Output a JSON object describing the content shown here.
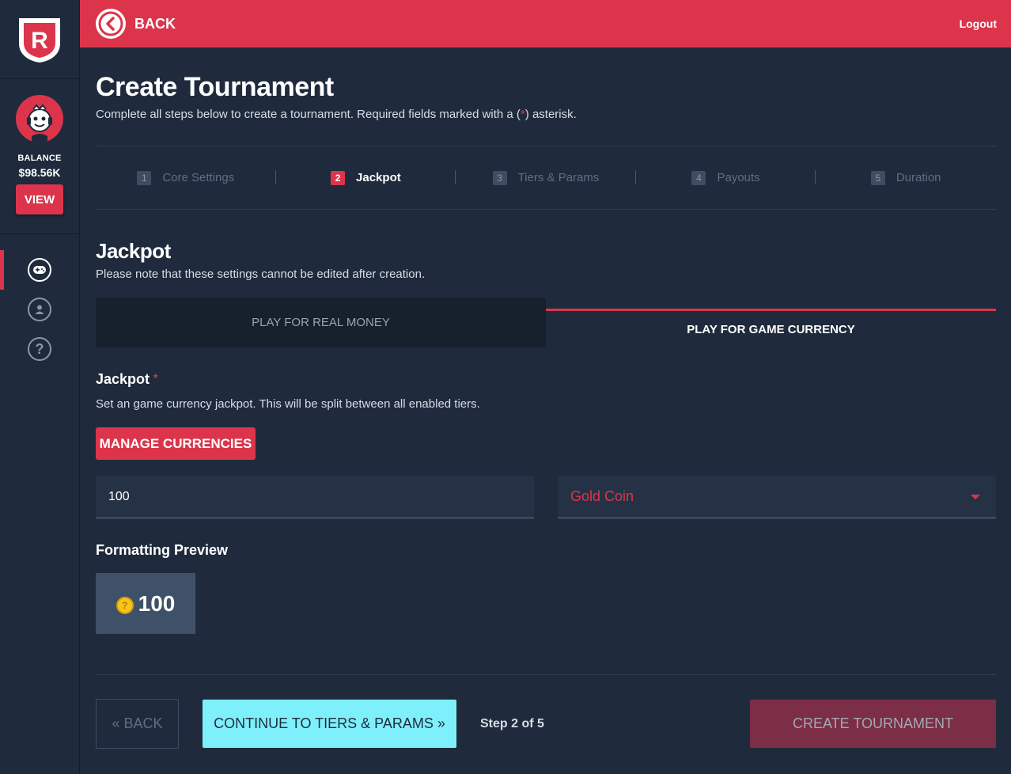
{
  "app": {
    "brand_letter": "R"
  },
  "sidebar": {
    "balance_label": "BALANCE",
    "balance_value": "$98.56K",
    "view_label": "VIEW",
    "nav": [
      {
        "icon": "gamepad-icon",
        "active": true
      },
      {
        "icon": "user-icon",
        "active": false
      },
      {
        "icon": "help-icon",
        "glyph": "?",
        "active": false
      }
    ]
  },
  "topbar": {
    "back_label": "BACK",
    "logout_label": "Logout"
  },
  "page": {
    "title": "Create Tournament",
    "subtitle_pre": "Complete all steps below to create a tournament. Required fields marked with a (",
    "subtitle_ast": "*",
    "subtitle_post": ") asterisk."
  },
  "steps": [
    {
      "num": "1",
      "label": "Core Settings",
      "active": false
    },
    {
      "num": "2",
      "label": "Jackpot",
      "active": true
    },
    {
      "num": "3",
      "label": "Tiers & Params",
      "active": false
    },
    {
      "num": "4",
      "label": "Payouts",
      "active": false
    },
    {
      "num": "5",
      "label": "Duration",
      "active": false
    }
  ],
  "section": {
    "title": "Jackpot",
    "subtitle": "Please note that these settings cannot be edited after creation."
  },
  "tabs": {
    "real_money": "PLAY FOR REAL MONEY",
    "game_currency": "PLAY FOR GAME CURRENCY"
  },
  "jackpot_field": {
    "title": "Jackpot",
    "required_mark": "*",
    "description": "Set an game currency jackpot. This will be split between all enabled tiers.",
    "manage_label": "MANAGE CURRENCIES",
    "amount_value": "100",
    "currency_selected": "Gold Coin"
  },
  "preview": {
    "title": "Formatting Preview",
    "coin_glyph": "?",
    "value": "100"
  },
  "footer": {
    "back_label": "« BACK",
    "continue_label": "CONTINUE TO TIERS & PARAMS »",
    "step_count": "Step 2 of 5",
    "create_label": "CREATE TOURNAMENT"
  },
  "colors": {
    "accent": "#dc354b",
    "background": "#1f2b3c",
    "continue": "#7ef0fc",
    "create_disabled": "#7b2e45",
    "coin": "#f5c518"
  }
}
